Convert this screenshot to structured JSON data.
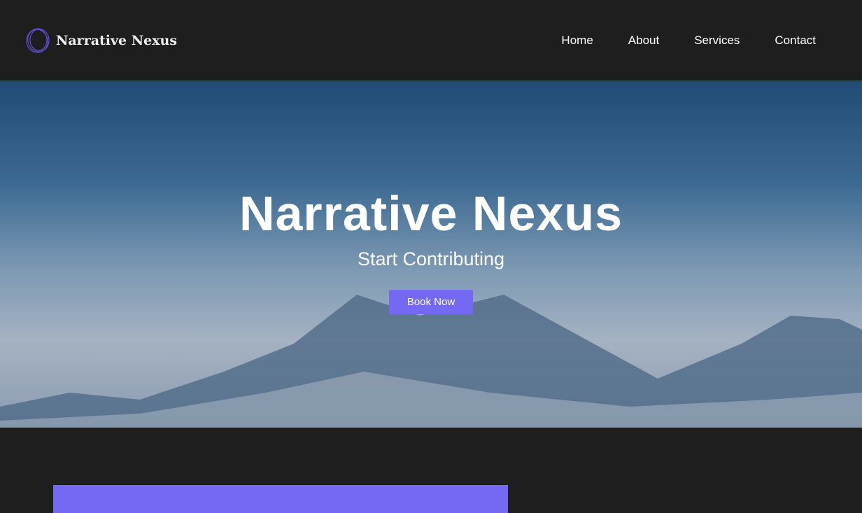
{
  "header": {
    "logo_text": "Narrative Nexus",
    "nav": [
      "Home",
      "About",
      "Services",
      "Contact"
    ]
  },
  "hero": {
    "title": "Narrative Nexus",
    "subtitle": "Start Contributing",
    "button": "Book Now"
  },
  "colors": {
    "accent": "#7569f4",
    "background": "#1e1e1e"
  }
}
